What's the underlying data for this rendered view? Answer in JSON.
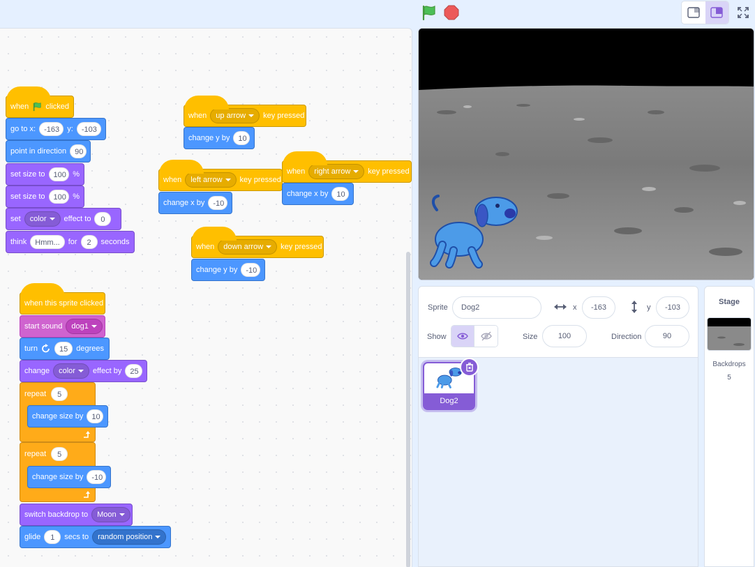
{
  "toolbar": {
    "green_flag_icon": "green-flag-icon",
    "stop_icon": "stop-icon"
  },
  "script1": {
    "hat_when": "when",
    "hat_clicked": "clicked",
    "goto_label": "go to x:",
    "goto_x": "-163",
    "goto_y_label": "y:",
    "goto_y": "-103",
    "point_label": "point in direction",
    "point_val": "90",
    "setsize1_label": "set size to",
    "setsize1_val": "100",
    "setsize1_unit": "%",
    "setsize2_label": "set size to",
    "setsize2_val": "100",
    "setsize2_unit": "%",
    "seteffect_label": "set",
    "seteffect_dd": "color",
    "seteffect_mid": "effect to",
    "seteffect_val": "0",
    "think_label": "think",
    "think_text": "Hmm...",
    "think_for": "for",
    "think_secs": "2",
    "think_unit": "seconds"
  },
  "key_scripts": [
    {
      "when": "when",
      "key": "up arrow",
      "pressed": "key pressed",
      "action": "change y by",
      "val": "10"
    },
    {
      "when": "when",
      "key": "left arrow",
      "pressed": "key pressed",
      "action": "change x by",
      "val": "-10"
    },
    {
      "when": "when",
      "key": "right arrow",
      "pressed": "key pressed",
      "action": "change x by",
      "val": "10"
    },
    {
      "when": "when",
      "key": "down arrow",
      "pressed": "key pressed",
      "action": "change y by",
      "val": "-10"
    }
  ],
  "script2": {
    "hat": "when this sprite clicked",
    "sound_label": "start sound",
    "sound_dd": "dog1",
    "turn_label": "turn",
    "turn_val": "15",
    "turn_unit": "degrees",
    "change_label": "change",
    "change_dd": "color",
    "change_mid": "effect by",
    "change_val": "25",
    "repeat1_label": "repeat",
    "repeat1_val": "5",
    "csize1_label": "change size by",
    "csize1_val": "10",
    "repeat2_label": "repeat",
    "repeat2_val": "5",
    "csize2_label": "change size by",
    "csize2_val": "-10",
    "backdrop_label": "switch backdrop to",
    "backdrop_dd": "Moon",
    "glide_label": "glide",
    "glide_val": "1",
    "glide_mid": "secs to",
    "glide_dd": "random position"
  },
  "sprite_info": {
    "sprite_label": "Sprite",
    "sprite_name": "Dog2",
    "x_label": "x",
    "x_val": "-163",
    "y_label": "y",
    "y_val": "-103",
    "show_label": "Show",
    "size_label": "Size",
    "size_val": "100",
    "direction_label": "Direction",
    "direction_val": "90"
  },
  "sprites": [
    {
      "name": "Dog2"
    }
  ],
  "stage_panel": {
    "title": "Stage",
    "backdrops_label": "Backdrops",
    "backdrops_count": "5"
  },
  "colors": {
    "events": "#ffbf00",
    "motion": "#4c97ff",
    "looks": "#9966ff",
    "sound": "#cf63cf",
    "control": "#ffab19",
    "accent": "#855cd6"
  }
}
